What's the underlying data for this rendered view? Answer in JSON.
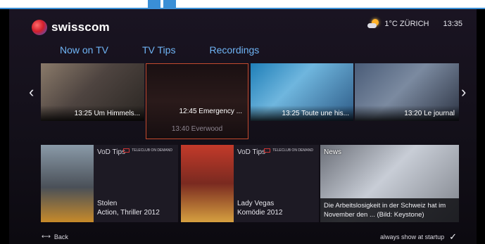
{
  "header": {
    "brand": "swisscom",
    "weather": "1°C ZÜRICH",
    "time": "13:35"
  },
  "tabs": [
    "Now on TV",
    "TV Tips",
    "Recordings"
  ],
  "channels": [
    {
      "caption": "13:25 Um Himmels..."
    },
    {
      "caption": "12:45 Emergency ...",
      "next": "13:40 Everwood"
    },
    {
      "caption": "13:25 Toute une his..."
    },
    {
      "caption": "13:20 Le journal"
    }
  ],
  "vod": [
    {
      "label": "VoD Tips",
      "badge": "TELECLUB ON DEMAND",
      "title": "Stolen",
      "meta": "Action, Thriller 2012"
    },
    {
      "label": "VoD Tips",
      "badge": "TELECLUB ON DEMAND",
      "title": "Lady Vegas",
      "meta": "Komödie 2012"
    }
  ],
  "news": {
    "label": "News",
    "caption": "Die Arbeitslosigkeit in der Schweiz hat im November den ... (Bild: Keystone)"
  },
  "footer": {
    "back": "Back",
    "startup": "always show at startup"
  },
  "icons": {
    "back": "back-arrow-icon",
    "check": "checkmark-icon",
    "weather": "partly-cloudy-icon"
  }
}
